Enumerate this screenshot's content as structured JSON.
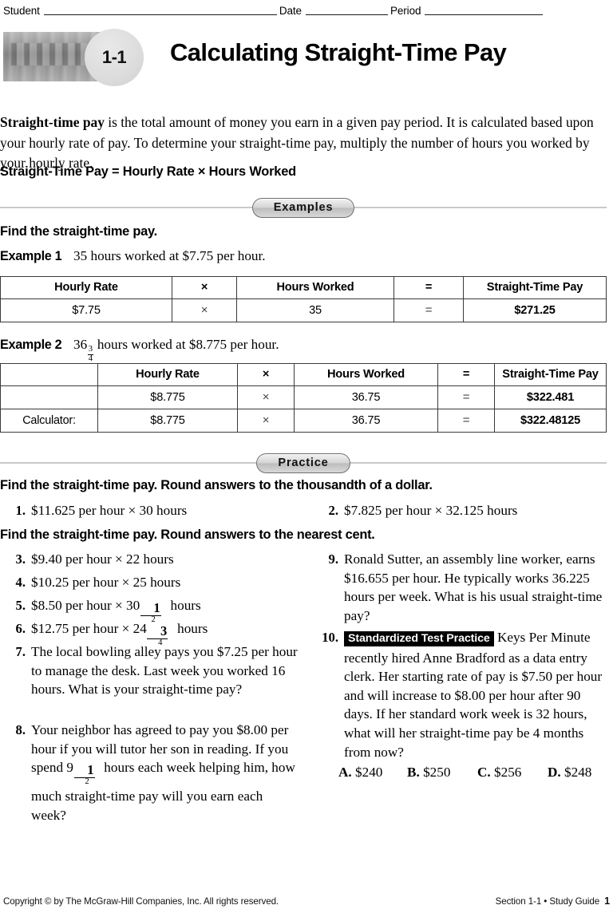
{
  "header": {
    "student_label": "Student",
    "date_label": "Date",
    "period_label": "Period"
  },
  "lesson": {
    "number": "1-1",
    "title": "Calculating Straight-Time Pay"
  },
  "intro": {
    "term": "Straight-time pay",
    "text": " is the total amount of money you earn in a given pay period. It is calculated based upon your hourly rate of pay. To determine your straight-time pay, multiply the number of hours you worked by your hourly rate.",
    "formula": "Straight-Time Pay = Hourly Rate × Hours Worked"
  },
  "sections": {
    "examples_pill": "Examples",
    "practice_pill": "Practice"
  },
  "examples": {
    "lead": "Find the straight-time pay.",
    "example1": {
      "label": "Example 1",
      "statement": "35 hours worked at $7.75 per hour."
    },
    "example2": {
      "label": "Example 2",
      "prefix": "36",
      "frac_num": "3",
      "frac_den": "4",
      "suffix": " hours worked at $8.775 per hour."
    },
    "table1": {
      "headers": [
        "Hourly Rate",
        "×",
        "Hours Worked",
        "=",
        "Straight-Time Pay"
      ],
      "rows": [
        [
          "$7.75",
          "×",
          "35",
          "=",
          "$271.25"
        ]
      ]
    },
    "table2": {
      "headers": [
        "",
        "Hourly Rate",
        "×",
        "Hours Worked",
        "=",
        "Straight-Time Pay"
      ],
      "rows": [
        [
          "",
          "$8.775",
          "×",
          "36.75",
          "=",
          "$322.481"
        ],
        [
          "Calculator:",
          "$8.775",
          "×",
          "36.75",
          "=",
          "$322.48125"
        ]
      ]
    }
  },
  "practice": {
    "lead_thousandth": "Find the straight-time pay. Round answers to the thousandth of a dollar.",
    "lead_cent": "Find the straight-time pay. Round answers to the nearest cent.",
    "problems": [
      {
        "number": "1.",
        "text": "$11.625 per hour × 30 hours"
      },
      {
        "number": "2.",
        "text": "$7.825 per hour × 32.125 hours"
      },
      {
        "number": "3.",
        "text": "$9.40 per hour × 22 hours"
      },
      {
        "number": "4.",
        "text": "$10.25 per hour × 25 hours"
      },
      {
        "number": "5.",
        "prefix": "$8.50 per hour × 30",
        "frac_num": "1",
        "frac_den": "2",
        "suffix": " hours"
      },
      {
        "number": "6.",
        "prefix": "$12.75 per hour × 24",
        "frac_num": "3",
        "frac_den": "4",
        "suffix": " hours"
      },
      {
        "number": "7.",
        "text": "The local bowling alley pays you $7.25 per hour to manage the desk. Last week you worked 16 hours. What is your straight-time pay?"
      },
      {
        "number": "8.",
        "prefix": "Your neighbor has agreed to pay you $8.00 per hour if you will tutor her son in reading. If you spend 9",
        "frac_num": "1",
        "frac_den": "2",
        "suffix": " hours each week helping him, how much straight-time pay will you earn each week?"
      },
      {
        "number": "9.",
        "text": "Ronald Sutter, an assembly line worker, earns $16.655 per hour. He typically works 36.225 hours per week. What is his usual straight-time pay?"
      },
      {
        "number": "10.",
        "badge": "Standardized Test Practice",
        "text": " Keys Per Minute recently hired Anne Bradford as a data entry clerk. Her starting rate of pay is $7.50 per hour and will increase to $8.00 per hour after 90 days. If her standard work week is 32 hours, what will her straight-time pay be 4 months from now?"
      }
    ],
    "choices": [
      {
        "letter": "A.",
        "value": "$240"
      },
      {
        "letter": "B.",
        "value": "$250"
      },
      {
        "letter": "C.",
        "value": "$256"
      },
      {
        "letter": "D.",
        "value": "$248"
      }
    ]
  },
  "footer": {
    "copyright": "Copyright © by The McGraw-Hill Companies, Inc. All rights reserved.",
    "section": "Section 1-1  •  Study Guide",
    "page": "1"
  },
  "colors": {
    "ink": "#000000",
    "rule": "#c9c9c9",
    "badge_fill": "#dcdcdc",
    "table_border": "#3a3a3a"
  }
}
